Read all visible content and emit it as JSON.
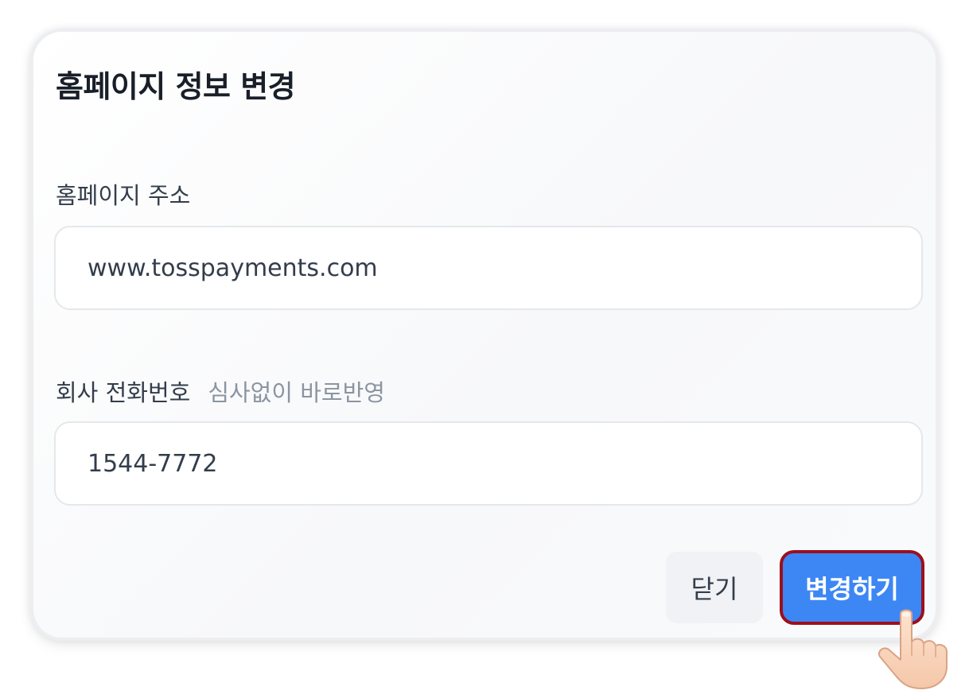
{
  "dialog": {
    "title": "홈페이지 정보 변경",
    "homepage_field": {
      "label": "홈페이지 주소",
      "value": "www.tosspayments.com"
    },
    "phone_field": {
      "label": "회사 전화번호",
      "hint": "심사없이 바로반영",
      "value": "1544-7772"
    },
    "buttons": {
      "close_label": "닫기",
      "apply_label": "변경하기"
    }
  },
  "colors": {
    "primary": "#3d87f5",
    "highlight_border": "#9c0f1e",
    "title_text": "#191f28",
    "hint_text": "#8b95a1"
  },
  "icons": {
    "pointer": "pointing-hand-icon"
  }
}
